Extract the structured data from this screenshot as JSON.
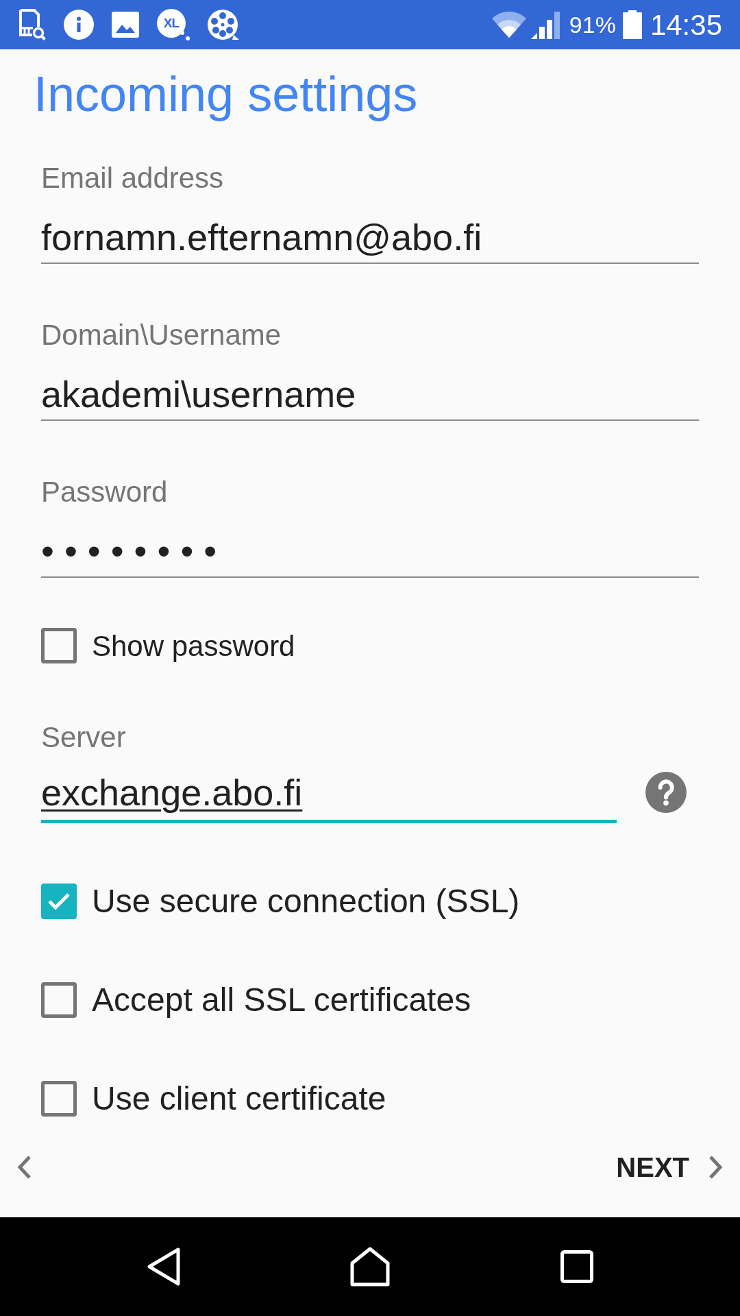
{
  "status_bar": {
    "notification_badge": "XL",
    "battery": "91%",
    "time": "14:35"
  },
  "title": "Incoming settings",
  "form": [
    {
      "kind": "field",
      "label": "Email address",
      "value": "fornamn.efternamn@abo.fi",
      "focused": false
    },
    {
      "kind": "field",
      "label": "Domain\\Username",
      "value": "akademi\\username",
      "focused": false
    },
    {
      "kind": "password",
      "label": "Password",
      "value": "••••••••",
      "focused": false
    },
    {
      "kind": "small_checkbox",
      "label": "Show password",
      "checked": false
    },
    {
      "kind": "field",
      "label": "Server",
      "value": "exchange.abo.fi",
      "focused": true,
      "help": true
    },
    {
      "kind": "checkbox",
      "label": "Use secure connection (SSL)",
      "checked": true
    },
    {
      "kind": "checkbox",
      "label": "Accept all SSL certificates",
      "checked": false
    },
    {
      "kind": "checkbox",
      "label": "Use client certificate",
      "checked": false
    }
  ],
  "navigation": {
    "next": "NEXT"
  }
}
